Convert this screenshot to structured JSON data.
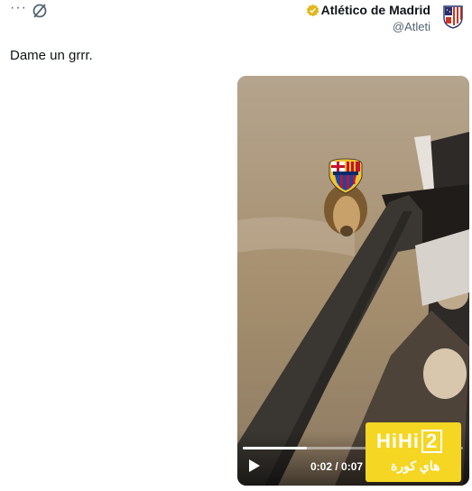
{
  "header": {
    "more_icon": "more-horizontal-icon",
    "edit_icon": "no-edit-icon",
    "account_name": "Atlético de Madrid",
    "account_handle": "@Atleti",
    "badge_icon": "verified-gold-icon",
    "crest_icon": "atletico-crest-icon",
    "crest_colors": [
      "#cb3524",
      "#27306b",
      "#ffffff"
    ]
  },
  "tweet": {
    "text": "Dame un grrr."
  },
  "video": {
    "time": "0:02 / 0:07",
    "progress": 0.29,
    "overlay_icon": "fc-barcelona-crest-icon",
    "play_icon": "play-icon"
  },
  "watermark": {
    "logo": "HiHi",
    "logo_num": "2",
    "subtitle": "هاي كورة",
    "color": "#f5d623"
  }
}
